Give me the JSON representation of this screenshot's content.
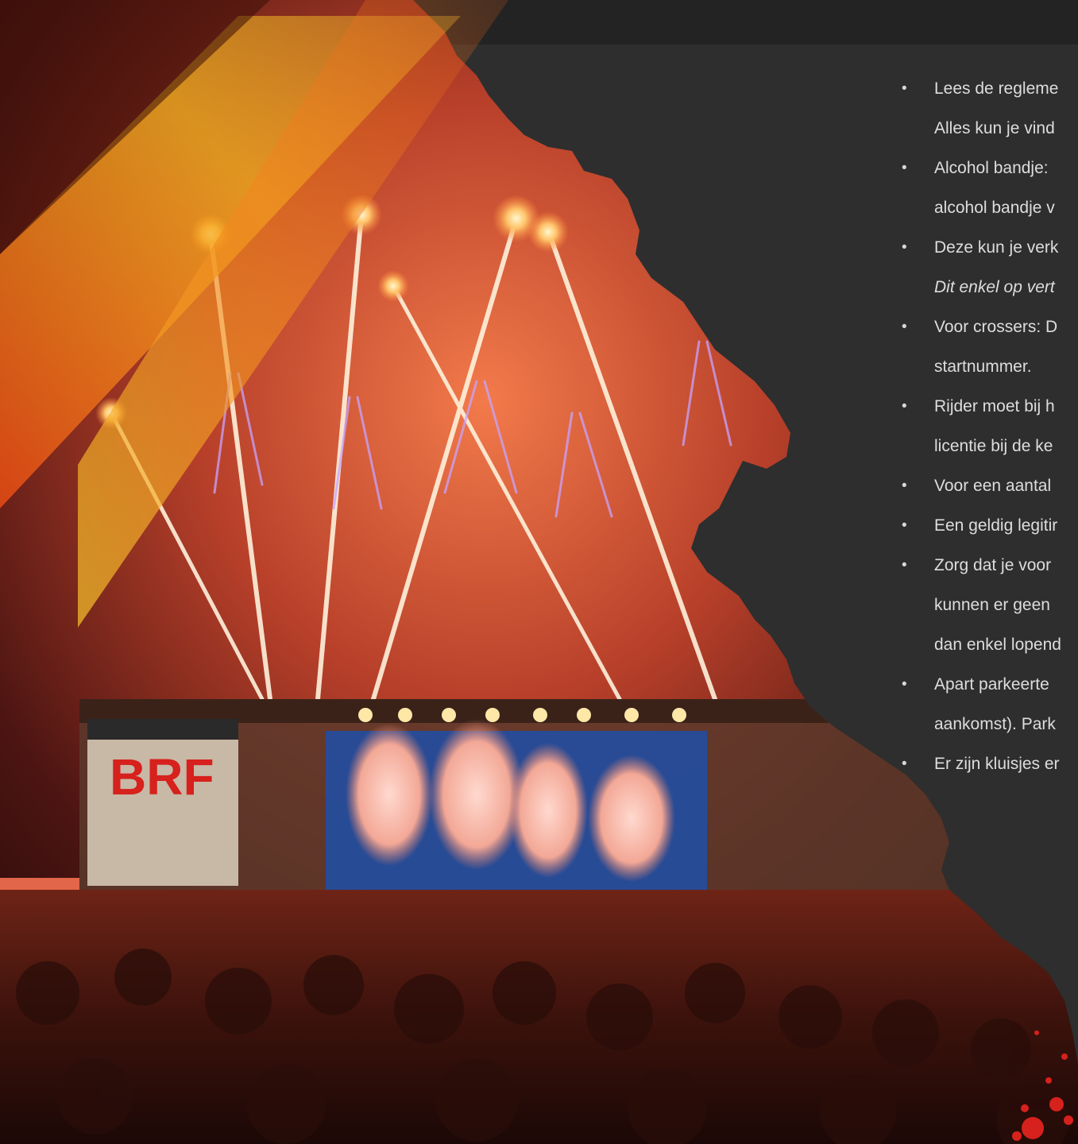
{
  "theme": {
    "background": "#2e2e2e",
    "band": "#232323",
    "text": "#dddddd",
    "accent_orange": "#f28a1f",
    "accent_yellow": "#f6c22a",
    "accent_red": "#d6211c"
  },
  "photo": {
    "subject": "festival-stage-fireworks",
    "banner_text": "BRF"
  },
  "bullet_symbol": "•",
  "items": [
    {
      "lines": [
        "Lees de regleme",
        "Alles kun je vind"
      ]
    },
    {
      "lines": [
        "Alcohol bandje:",
        "alcohol bandje v"
      ]
    },
    {
      "lines": [
        "Deze kun je verk",
        "Dit enkel op vert"
      ],
      "italic_second_line": true
    },
    {
      "lines": [
        "Voor crossers: D",
        "startnummer."
      ]
    },
    {
      "lines": [
        "Rijder moet bij h",
        "licentie bij de ke"
      ]
    },
    {
      "lines": [
        "Voor een aantal"
      ]
    },
    {
      "lines": [
        "Een geldig legitir"
      ]
    },
    {
      "lines": [
        "Zorg dat je voor",
        "kunnen er geen",
        "dan enkel lopend"
      ]
    },
    {
      "lines": [
        "Apart parkeerte",
        "aankomst). Park"
      ]
    },
    {
      "lines": [
        "Er zijn kluisjes  er"
      ]
    }
  ]
}
